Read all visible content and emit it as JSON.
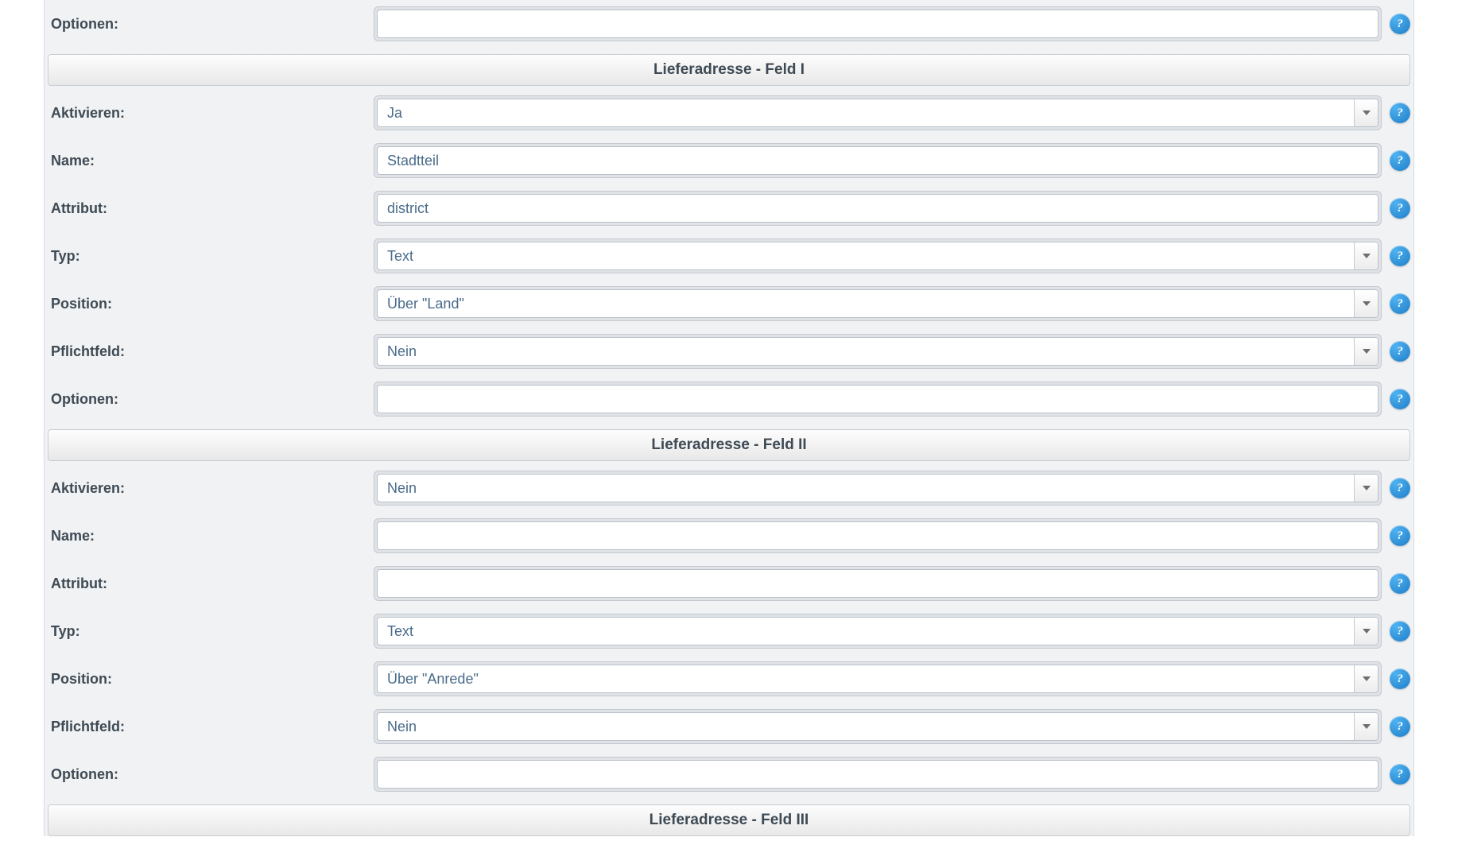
{
  "labels": {
    "optionen": "Optionen:",
    "aktivieren": "Aktivieren:",
    "name": "Name:",
    "attribut": "Attribut:",
    "typ": "Typ:",
    "position": "Position:",
    "pflichtfeld": "Pflichtfeld:"
  },
  "help_glyph": "?",
  "section0": {
    "optionen": ""
  },
  "section1": {
    "title": "Lieferadresse - Feld I",
    "aktivieren": "Ja",
    "name": "Stadtteil",
    "attribut": "district",
    "typ": "Text",
    "position": "Über \"Land\"",
    "pflichtfeld": "Nein",
    "optionen": ""
  },
  "section2": {
    "title": "Lieferadresse - Feld II",
    "aktivieren": "Nein",
    "name": "",
    "attribut": "",
    "typ": "Text",
    "position": "Über \"Anrede\"",
    "pflichtfeld": "Nein",
    "optionen": ""
  },
  "section3": {
    "title": "Lieferadresse - Feld III"
  }
}
